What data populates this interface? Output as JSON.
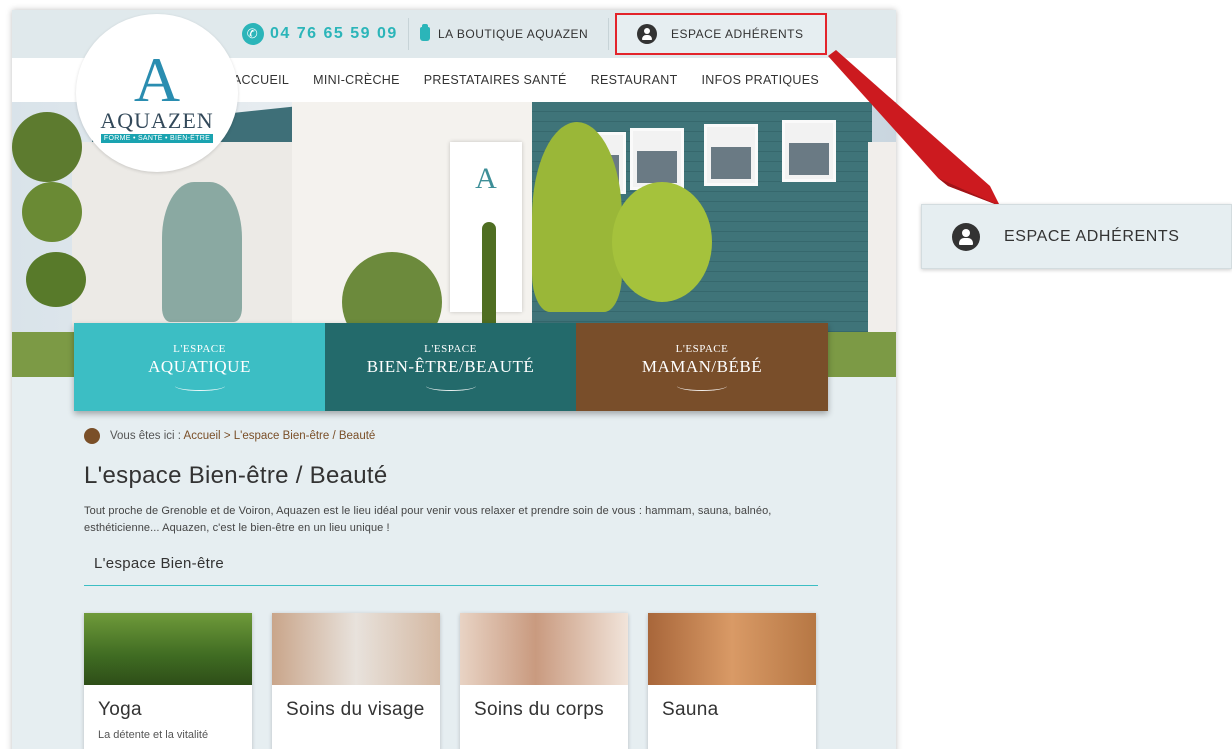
{
  "topbar": {
    "phone": "04 76 65 59 09",
    "shop_label": "LA BOUTIQUE AQUAZEN",
    "members_label": "ESPACE ADHÉRENTS"
  },
  "logo": {
    "letter": "A",
    "name": "AQUAZEN",
    "tagline": "FORME • SANTÉ • BIEN-ÊTRE"
  },
  "nav": {
    "items": [
      {
        "label": "ACCUEIL"
      },
      {
        "label": "MINI-CRÈCHE"
      },
      {
        "label": "PRESTATAIRES SANTÉ"
      },
      {
        "label": "RESTAURANT"
      },
      {
        "label": "INFOS PRATIQUES"
      }
    ]
  },
  "hero": {
    "sign_letter": "A"
  },
  "tiles": [
    {
      "pre": "L'ESPACE",
      "main": "AQUATIQUE",
      "color": "#3cbec4"
    },
    {
      "pre": "L'ESPACE",
      "main": "BIEN-ÊTRE/BEAUTÉ",
      "color": "#236a6b"
    },
    {
      "pre": "L'ESPACE",
      "main": "MAMAN/BÉBÉ",
      "color": "#794e2a"
    }
  ],
  "breadcrumb": {
    "prefix": "Vous êtes ici :",
    "home": "Accueil",
    "separator": ">",
    "current": "L'espace Bien-être / Beauté"
  },
  "page": {
    "title": "L'espace Bien-être / Beauté",
    "intro": "Tout proche de Grenoble et de Voiron, Aquazen est le lieu idéal pour venir vous relaxer et prendre soin de vous : hammam, sauna, balnéo, esthéticienne... Aquazen, c'est le bien-être en un lieu unique !",
    "section_title": "L'espace Bien-être"
  },
  "cards": [
    {
      "title": "Yoga",
      "text": "La détente et la vitalité"
    },
    {
      "title": "Soins du visage",
      "text": ""
    },
    {
      "title": "Soins du corps",
      "text": ""
    },
    {
      "title": "Sauna",
      "text": ""
    }
  ],
  "callout": {
    "label": "ESPACE ADHÉRENTS",
    "highlight_color": "#e3242b"
  }
}
